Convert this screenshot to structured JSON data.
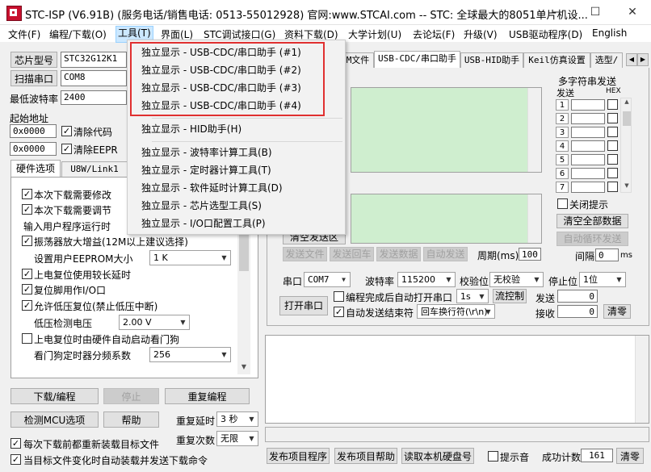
{
  "window": {
    "title": "STC-ISP (V6.91B) (服务电话/销售电话: 0513-55012928) 官网:www.STCAI.com  -- STC: 全球最大的8051单片机设...",
    "minimize": "—",
    "maximize": "☐",
    "close": "✕"
  },
  "menu": [
    "文件(F)",
    "编程/下载(O)",
    "工具(T)",
    "界面(L)",
    "STC调试接口(G)",
    "资料下载(D)",
    "大学计划(U)",
    "去论坛(F)",
    "升级(V)",
    "USB驱动程序(D)",
    "English"
  ],
  "dropdown": {
    "items": [
      "独立显示 - USB-CDC/串口助手 (#1)",
      "独立显示 - USB-CDC/串口助手 (#2)",
      "独立显示 - USB-CDC/串口助手 (#3)",
      "独立显示 - USB-CDC/串口助手 (#4)",
      "独立显示 - HID助手(H)",
      "独立显示 - 波特率计算工具(B)",
      "独立显示 - 定时器计算工具(T)",
      "独立显示 - 软件延时计算工具(D)",
      "独立显示 - 芯片选型工具(S)",
      "独立显示 - I/O口配置工具(P)"
    ]
  },
  "left": {
    "chip_btn": "芯片型号",
    "chip_value": "STC32G12K1",
    "scan_btn": "扫描串口",
    "port_value": "COM8",
    "min_baud_label": "最低波特率",
    "min_baud_value": "2400",
    "start_addr_label": "起始地址",
    "addr1": "0x0000",
    "clear_code": "清除代码",
    "addr2": "0x0000",
    "clear_eeprom": "清除EEPR",
    "tab_hw": "硬件选项",
    "tab_usb": "U8W/Link1",
    "options": {
      "opt1": "本次下载需要修改",
      "opt2": "本次下载需要调节",
      "opt3": "输入用户程序运行时",
      "opt4": "振荡器放大增益(12M以上建议选择)",
      "eeprom_size_label": "设置用户EEPROM大小",
      "eeprom_size_value": "1    K",
      "opt5": "上电复位使用较长延时",
      "opt6": "复位脚用作I/O口",
      "opt7": "允许低压复位(禁止低压中断)",
      "lv_label": "低压检测电压",
      "lv_value": "2.00 V",
      "opt8": "上电复位时由硬件自动启动看门狗",
      "wdt_label": "看门狗定时器分频系数",
      "wdt_value": "256"
    },
    "download_btn": "下载/编程",
    "stop_btn": "停止",
    "reprogram_btn": "重复编程",
    "detect_btn": "检测MCU选项",
    "help_btn": "帮助",
    "repeat_delay_label": "重复延时",
    "repeat_delay_value": "3 秒",
    "repeat_count_label": "重复次数",
    "repeat_count_value": "无限",
    "reload_before": "每次下载前都重新装载目标文件",
    "auto_load": "当目标文件变化时自动装载并发送下载命令"
  },
  "right": {
    "tab_mcu": "M文件",
    "tab_cdc": "USB-CDC/串口助手",
    "tab_hid": "USB-HID助手",
    "tab_keil": "Keil仿真设置",
    "tab_sel": "选型/",
    "multi_title": "多字符串发送",
    "send_header": "发送",
    "hex_header": "HEX",
    "rows": [
      "1",
      "2",
      "3",
      "4",
      "5",
      "6",
      "7"
    ],
    "close_tip": "关闭提示",
    "clear_all": "清空全部数据",
    "auto_loop": "自动循环发送",
    "interval_label": "间隔",
    "interval_value": "0",
    "interval_unit": "ms",
    "clear_send": "清空发送区",
    "send_file": "发送文件",
    "send_enter": "发送回车",
    "send_data": "发送数据",
    "auto_send": "自动发送",
    "period_label": "周期(ms)",
    "period_value": "100",
    "port_label": "串口",
    "port_value": "COM7",
    "baud_label": "波特率",
    "baud_value": "115200",
    "parity_label": "校验位",
    "parity_value": "无校验",
    "stop_label": "停止位",
    "stop_value": "1位",
    "open_btn": "打开串口",
    "auto_open": "编程完成后自动打开串口",
    "auto_open_port": "1s",
    "flow_btn": "流控制",
    "send_count_label": "发送",
    "send_count": "0",
    "auto_send_end": "自动发送结束符",
    "newline_value": "回车换行符(\\r\\n)",
    "recv_count_label": "接收",
    "recv_count": "0",
    "clear_btn": "清零",
    "publish_prog": "发布项目程序",
    "publish_help": "发布项目帮助",
    "read_disk": "读取本机硬盘号",
    "beep": "提示音",
    "success_label": "成功计数",
    "success_value": "161",
    "clear_bottom": "清零"
  }
}
